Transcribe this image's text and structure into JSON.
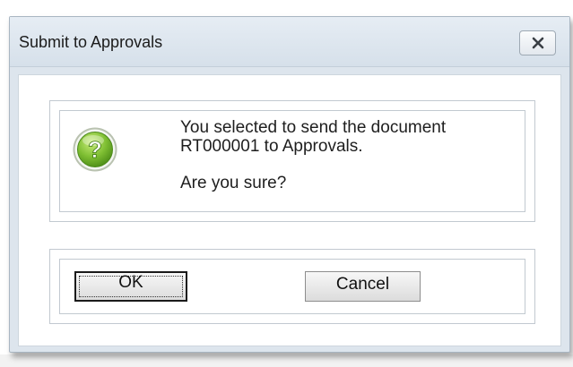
{
  "dialog": {
    "title": "Submit to Approvals",
    "close_icon": "close-icon",
    "message": {
      "icon": "question-icon",
      "icon_glyph": "?",
      "line1": "You selected to send the document",
      "line2": "RT000001 to Approvals.",
      "question": "Are you sure?"
    },
    "buttons": {
      "ok_label": "OK",
      "cancel_label": "Cancel"
    }
  },
  "colors": {
    "titlebar_bg": "#dde5ed",
    "icon_green": "#6cb02c",
    "focus_border": "#1a1a1a"
  }
}
